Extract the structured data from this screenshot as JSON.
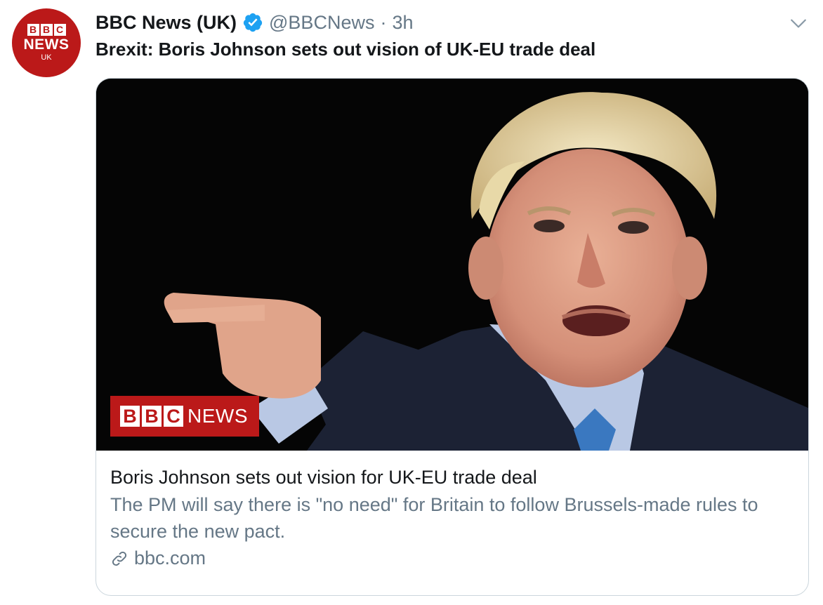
{
  "author": {
    "avatar": {
      "blocks": [
        "B",
        "B",
        "C"
      ],
      "news": "NEWS",
      "region": "UK"
    },
    "name": "BBC News (UK)",
    "handle": "@BBCNews",
    "separator": "·",
    "time": "3h"
  },
  "tweet": {
    "text": "Brexit: Boris Johnson sets out vision of UK-EU trade deal"
  },
  "card": {
    "badge": {
      "blocks": [
        "B",
        "B",
        "C"
      ],
      "news": "NEWS"
    },
    "title": "Boris Johnson sets out vision for UK-EU trade deal",
    "description": "The PM will say there is \"no need\" for Britain to follow Brussels-made rules to secure the new pact.",
    "domain": "bbc.com"
  },
  "icons": {
    "verified": "verified-badge-icon",
    "menu": "chevron-down-icon",
    "link": "link-icon"
  },
  "colors": {
    "bbc_red": "#bb1919",
    "verified_blue": "#1da1f2",
    "secondary_text": "#657786"
  }
}
